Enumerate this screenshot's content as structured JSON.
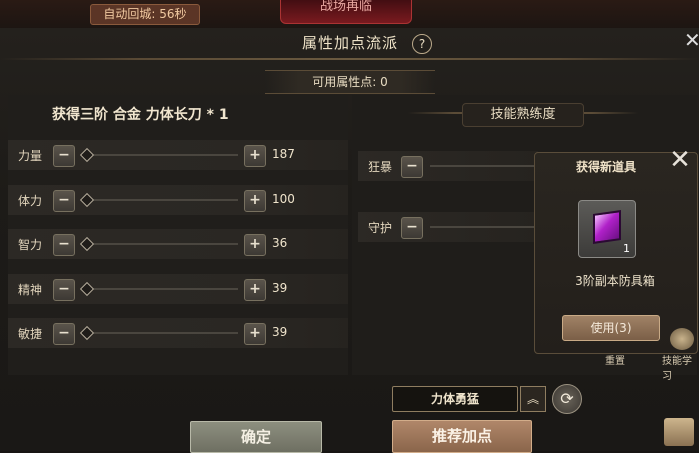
{
  "top": {
    "timer": "自动回城: 56秒",
    "red_tab": "战场再临"
  },
  "panel": {
    "title": "属性加点流派",
    "help_icon": "?",
    "available_points_label": "可用属性点: 0",
    "gain_text": "获得三阶 合金 力体长刀 * 1",
    "skill_header": "技能熟练度"
  },
  "attributes": [
    {
      "label": "力量",
      "value": "187"
    },
    {
      "label": "体力",
      "value": "100"
    },
    {
      "label": "智力",
      "value": "36"
    },
    {
      "label": "精神",
      "value": "39"
    },
    {
      "label": "敏捷",
      "value": "39"
    }
  ],
  "skills": [
    {
      "label": "狂暴"
    },
    {
      "label": "守护"
    }
  ],
  "popup": {
    "title": "获得新道具",
    "item_count": "1",
    "item_name": "3阶副本防具箱",
    "use_button": "使用(3)"
  },
  "side": {
    "reset_label": "重置",
    "skill_learn_label": "技能学习"
  },
  "bottom": {
    "preset_select": "力体勇猛",
    "confirm_button": "确定",
    "recommend_button": "推荐加点"
  },
  "colors": {
    "panel_bg": "#1d1b18",
    "accent": "#b0876a",
    "item_purple": "#b021c9"
  }
}
